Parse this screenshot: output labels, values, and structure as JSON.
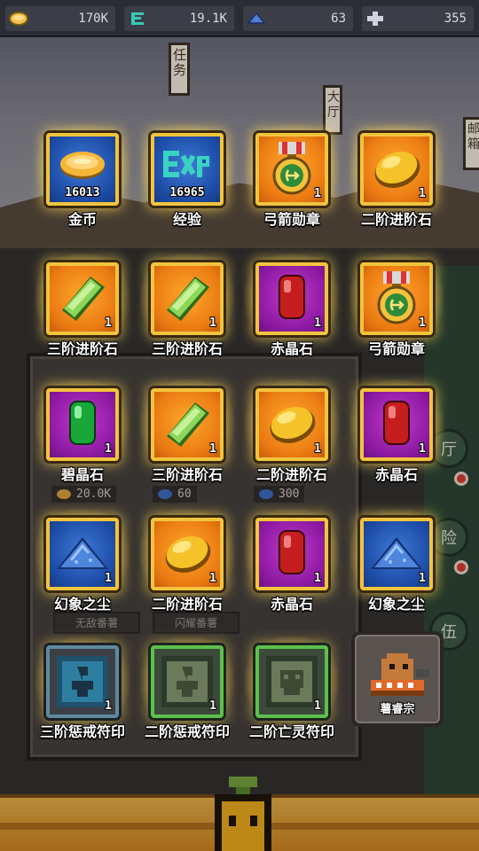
{
  "resources": [
    {
      "icon": "gold-coin-icon",
      "value": "170K",
      "color": "#f2c14e"
    },
    {
      "icon": "experience-e-icon",
      "value": "19.1K",
      "color": "#38c9b8"
    },
    {
      "icon": "blue-dust-icon",
      "value": "63",
      "color": "#4d7fd6"
    },
    {
      "icon": "plus-cross-icon",
      "value": "355",
      "color": "#cfd3dd"
    }
  ],
  "background": {
    "sign_task": "任务",
    "sign_hall": "大厅",
    "sign_mail": "邮箱",
    "label_left": "无敌番薯",
    "label_mid": "闪耀番薯",
    "cost_gold": "20.0K",
    "cost_dust_a": "60",
    "cost_dust_b": "300",
    "side_hall": "厅",
    "side_adventure": "险",
    "side_team": "伍"
  },
  "rewards": [
    {
      "name": "金币",
      "count": "16013",
      "icon": "gold-coin-icon",
      "bg": "blue"
    },
    {
      "name": "经验",
      "count": "16965",
      "icon": "experience-exp-icon",
      "bg": "blue"
    },
    {
      "name": "弓箭勋章",
      "count": "1",
      "icon": "archer-medal-icon",
      "bg": "orange"
    },
    {
      "name": "二阶进阶石",
      "count": "1",
      "icon": "yellow-stone-icon",
      "bg": "orange"
    },
    {
      "name": "三阶进阶石",
      "count": "1",
      "icon": "green-crystal-icon",
      "bg": "orange"
    },
    {
      "name": "三阶进阶石",
      "count": "1",
      "icon": "green-crystal-icon",
      "bg": "orange"
    },
    {
      "name": "赤晶石",
      "count": "1",
      "icon": "red-gem-icon",
      "bg": "purple"
    },
    {
      "name": "弓箭勋章",
      "count": "1",
      "icon": "archer-medal-icon",
      "bg": "orange"
    },
    {
      "name": "碧晶石",
      "count": "1",
      "icon": "green-gem-icon",
      "bg": "purple"
    },
    {
      "name": "三阶进阶石",
      "count": "1",
      "icon": "green-crystal-icon",
      "bg": "orange"
    },
    {
      "name": "二阶进阶石",
      "count": "1",
      "icon": "yellow-stone-icon",
      "bg": "orange"
    },
    {
      "name": "赤晶石",
      "count": "1",
      "icon": "red-gem-icon",
      "bg": "purple"
    },
    {
      "name": "幻象之尘",
      "count": "1",
      "icon": "blue-dust-icon",
      "bg": "blue"
    },
    {
      "name": "二阶进阶石",
      "count": "1",
      "icon": "yellow-stone-icon",
      "bg": "orange"
    },
    {
      "name": "赤晶石",
      "count": "1",
      "icon": "red-gem-icon",
      "bg": "purple"
    },
    {
      "name": "幻象之尘",
      "count": "1",
      "icon": "blue-dust-icon",
      "bg": "blue"
    },
    {
      "name": "三阶惩戒符印",
      "count": "1",
      "icon": "blue-punish-seal-icon",
      "bg": "gray"
    },
    {
      "name": "二阶惩戒符印",
      "count": "1",
      "icon": "green-punish-seal-icon",
      "bg": "green-frame"
    },
    {
      "name": "二阶亡灵符印",
      "count": "1",
      "icon": "undead-seal-icon",
      "bg": "green-frame"
    }
  ],
  "npc": {
    "name": "薯睿宗",
    "icon": "potato-npc-icon"
  }
}
